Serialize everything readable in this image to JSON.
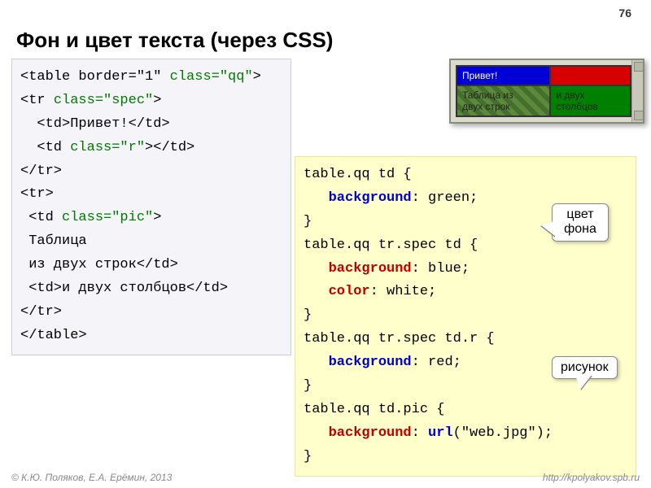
{
  "page_number": "76",
  "title": "Фон и цвет текста (через CSS)",
  "html_code": {
    "l1a": "<table border=\"1\" ",
    "l1b": "class=\"qq\"",
    "l1c": ">",
    "l2a": "<tr ",
    "l2b": "class=\"spec\"",
    "l2c": ">",
    "l3": "  <td>Привет!</td>",
    "l4a": "  <td ",
    "l4b": "class=\"r\"",
    "l4c": "></td>",
    "l5": "</tr>",
    "l6": "<tr>",
    "l7a": " <td ",
    "l7b": "class=\"pic\"",
    "l7c": ">",
    "l8": " Таблица",
    "l9": " из двух строк</td>",
    "l10": " <td>и двух столбцов</td>",
    "l11": "</tr>",
    "l12": "</table>"
  },
  "css_code": {
    "s1": "table.qq td {",
    "s2_prop": "background",
    "s2_rest": ": green;",
    "s3": "}",
    "s4": "table.qq tr.spec td {",
    "s5_prop": "background",
    "s5_rest": ": blue;",
    "s6_prop": "color",
    "s6_rest": ": white;",
    "s7": "}",
    "s8": "table.qq tr.spec td.r {",
    "s9_prop": "background",
    "s9_rest": ": red;",
    "s10": "}",
    "s11": "table.qq td.pic {",
    "s12_prop": "background",
    "s12_mid": ": ",
    "s12_fn": "url",
    "s12_arg": "(\"web.jpg\");",
    "s13": "}"
  },
  "preview": {
    "cell_hello": "Привет!",
    "cell_r": "",
    "cell_pic_l1": "Таблица из",
    "cell_pic_l2": "двух строк",
    "cell_cols_l1": "и двух",
    "cell_cols_l2": "столбцов"
  },
  "bubbles": {
    "b1_l1": "цвет",
    "b1_l2": "фона",
    "b2": "рисунок"
  },
  "footer": {
    "left": "© К.Ю. Поляков, Е.А. Ерёмин, 2013",
    "right": "http://kpolyakov.spb.ru"
  }
}
